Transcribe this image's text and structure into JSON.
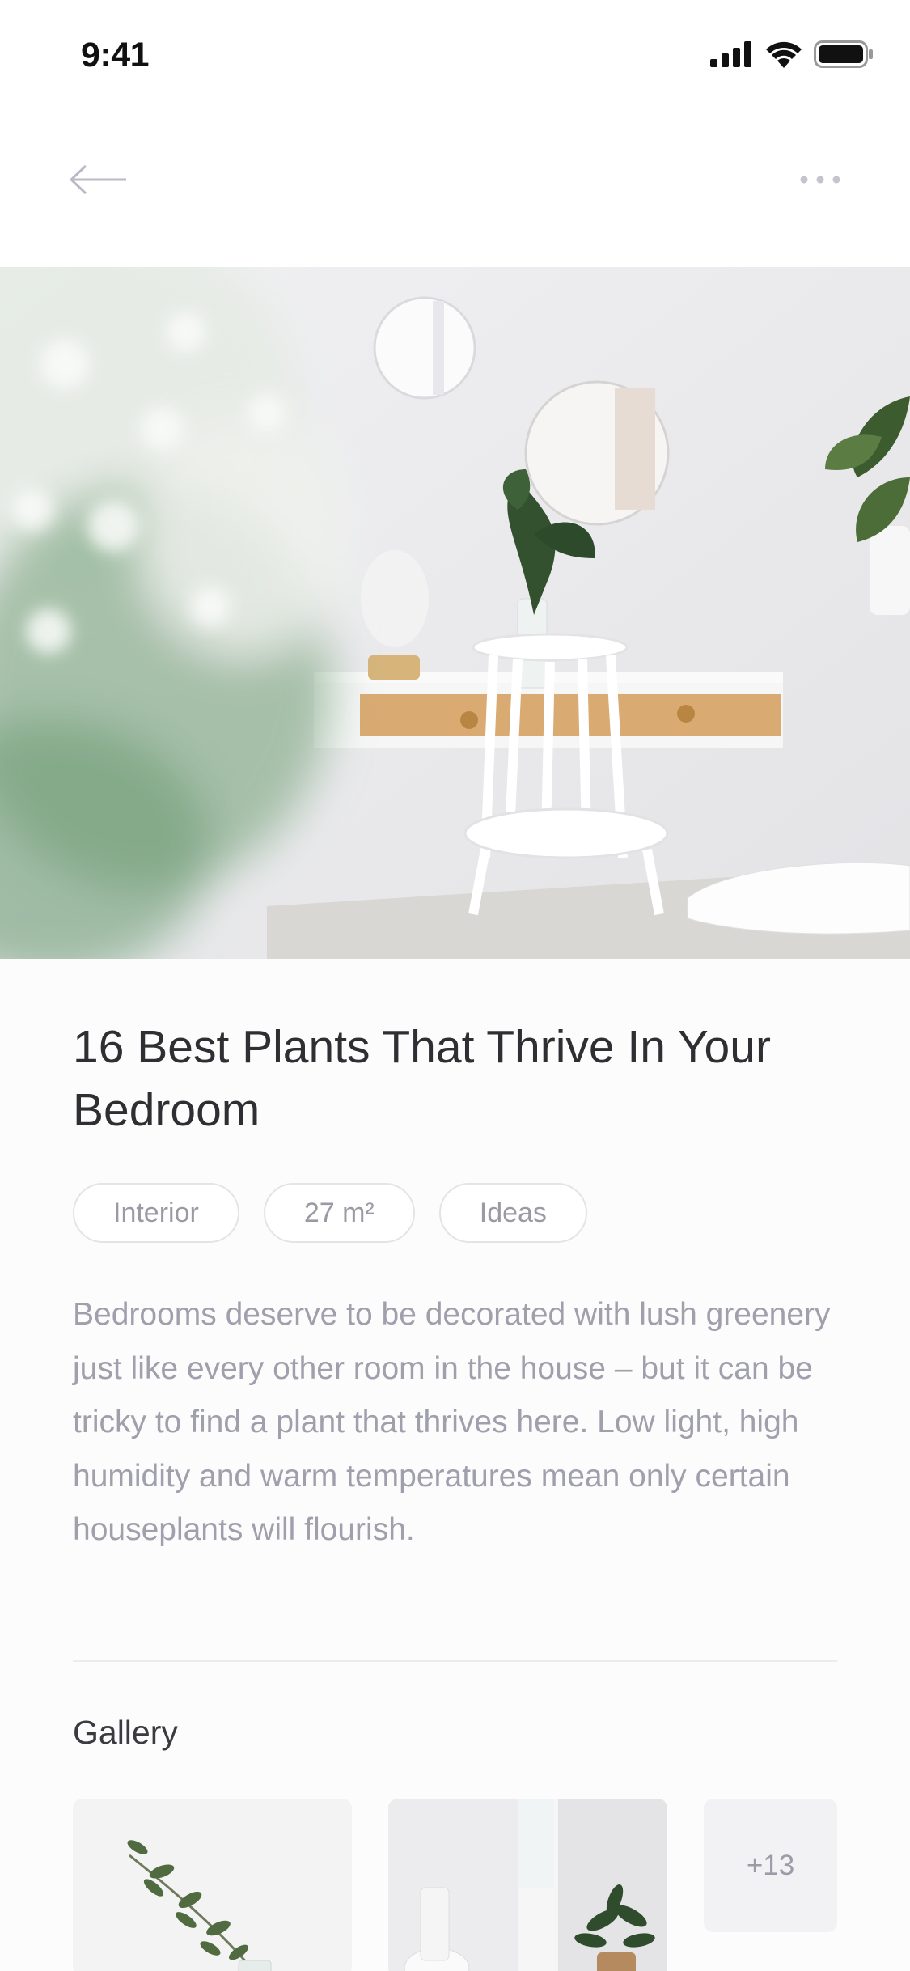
{
  "status_bar": {
    "time": "9:41"
  },
  "navbar": {
    "back_icon": "arrow-left-icon",
    "more_icon": "more-horizontal-icon"
  },
  "article": {
    "title": "16 Best Plants That Thrive In Your Bedroom",
    "tags": [
      "Interior",
      "27 m²",
      "Ideas"
    ],
    "description": "Bedrooms deserve to be decorated with lush greenery just like every other room in the house – but it can be tricky to find a plant that thrives here. Low light, high humidity and warm temperatures mean only certain houseplants will flourish."
  },
  "gallery": {
    "title": "Gallery",
    "more_count": "+13"
  },
  "colors": {
    "background": "#fdfcfc",
    "title_text": "#2f2f33",
    "muted_text": "#a0a0ad",
    "tag_border": "#e3e3e8"
  }
}
